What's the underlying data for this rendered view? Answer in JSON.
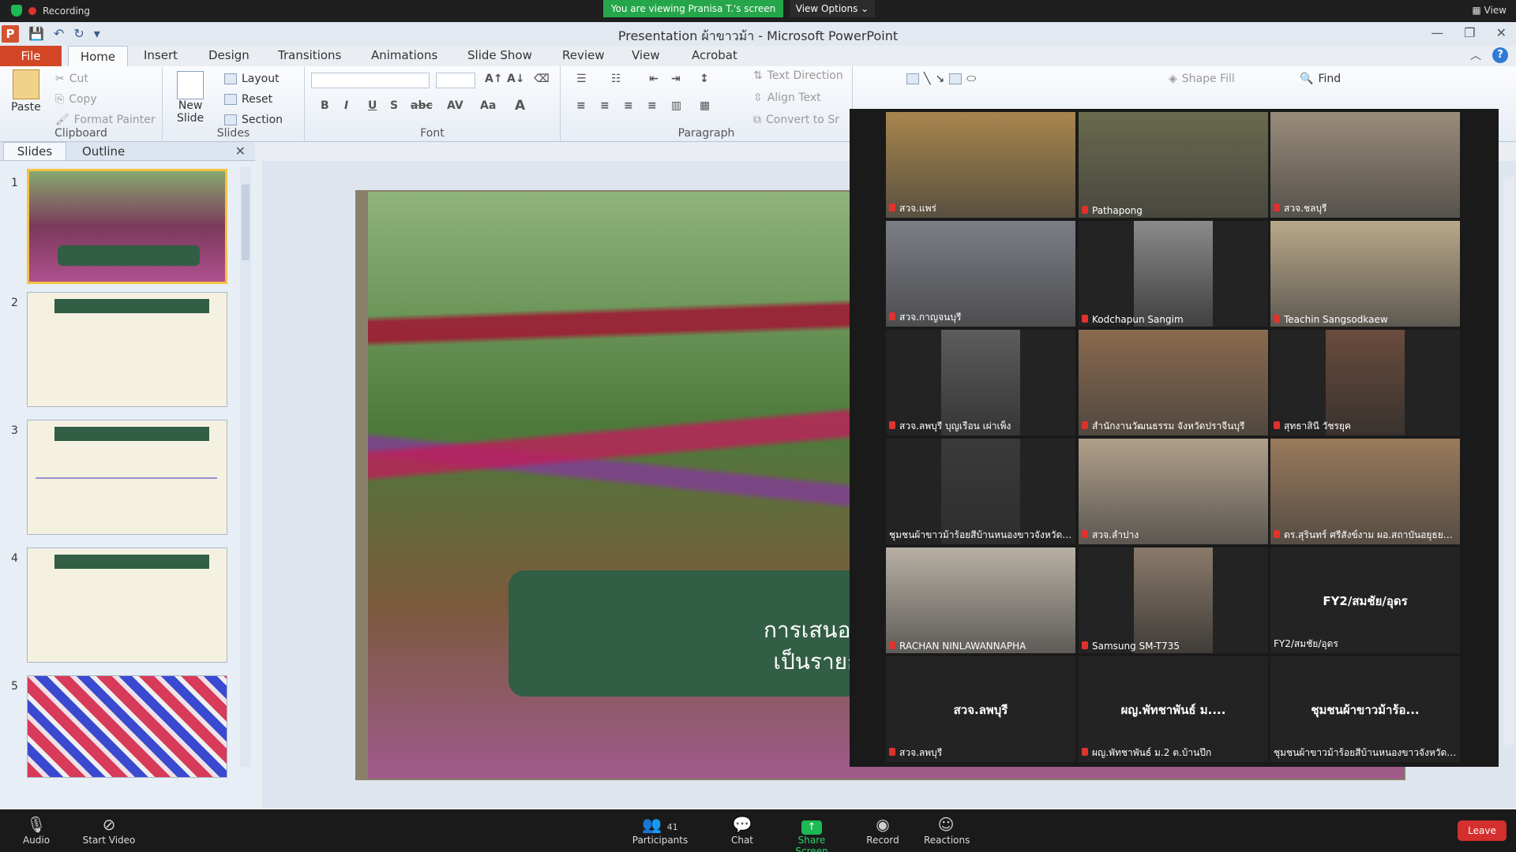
{
  "zoom": {
    "recording_label": "Recording",
    "viewing_banner": "You are viewing Pranisa T.'s screen",
    "view_options": "View Options ⌄",
    "view_label": "View",
    "bottom": {
      "audio": "Audio",
      "start_video": "Start Video",
      "participants": "Participants",
      "participants_count": "41",
      "chat": "Chat",
      "share_screen": "Share Screen",
      "record": "Record",
      "reactions": "Reactions",
      "leave": "Leave"
    },
    "tiles": [
      {
        "name": "สวจ.แพร่",
        "type": "video",
        "bg": "#a8864e"
      },
      {
        "name": "Pathapong",
        "type": "video",
        "bg": "#6a6a4e"
      },
      {
        "name": "สวจ.ชลบุรี",
        "type": "video",
        "bg": "#9a8c7a"
      },
      {
        "name": "สวจ.กาญจนบุรี",
        "type": "video",
        "bg": "#7c7e86"
      },
      {
        "name": "Kodchapun Sangim",
        "type": "video-narrow",
        "bg": "#8a8a8a"
      },
      {
        "name": "Teachin Sangsodkaew",
        "type": "video",
        "bg": "#b9a88a"
      },
      {
        "name": "สวจ.ลพบุรี บุญเรือน เผ่าเพ็ง",
        "type": "video-narrow",
        "bg": "#5c5c5c"
      },
      {
        "name": "สำนักงานวัฒนธรรม จังหวัดปราจีนบุรี",
        "type": "video",
        "bg": "#8a6a4e"
      },
      {
        "name": "สุทธาสินี วัชรยุค",
        "type": "video-narrow",
        "bg": "#6a4c3c"
      },
      {
        "name": "ชุมชนผ้าขาวม้าร้อยสีบ้านหนองขาวจังหวัดกา...",
        "type": "video-narrow",
        "bg": "#3a3a3a",
        "nomic": true
      },
      {
        "name": "สวจ.ลำปาง",
        "type": "video",
        "bg": "#b0a08a"
      },
      {
        "name": "ดร.สุรินทร์ ศรีสังข์งาม ผอ.สถาบันอยุธยาศึ...",
        "type": "video",
        "bg": "#9a7a5c"
      },
      {
        "name": "RACHAN NINLAWANNAPHA",
        "type": "video",
        "bg": "#b8b0a4"
      },
      {
        "name": "Samsung SM-T735",
        "type": "video-narrow",
        "bg": "#8a7a6a"
      },
      {
        "name": "FY2/สมชัย/อุดร",
        "type": "name",
        "center": "FY2/สมชัย/อุดร",
        "nomic": true
      },
      {
        "name": "สวจ.ลพบุรี",
        "type": "name",
        "center": "สวจ.ลพบุรี"
      },
      {
        "name": "ผญ.พัทชาพันธ์ ม.2 ต.บ้านปึก",
        "type": "name",
        "center": "ผญ.พัทชาพันธ์ ม...."
      },
      {
        "name": "ชุมชนผ้าขาวม้าร้อยสีบ้านหนองขาวจังหวัดกา...",
        "type": "name",
        "center": "ชุมชนผ้าขาวม้าร้อ...",
        "nomic": true
      }
    ]
  },
  "ppt": {
    "title": "Presentation ผ้าขาวม้า - Microsoft PowerPoint",
    "tabs": [
      "File",
      "Home",
      "Insert",
      "Design",
      "Transitions",
      "Animations",
      "Slide Show",
      "Review",
      "View",
      "Acrobat"
    ],
    "clipboard": {
      "label": "Clipboard",
      "paste": "Paste",
      "cut": "Cut",
      "copy": "Copy",
      "format_painter": "Format Painter"
    },
    "slides_grp": {
      "label": "Slides",
      "new_slide_1": "New",
      "new_slide_2": "Slide",
      "layout": "Layout",
      "reset": "Reset",
      "section": "Section"
    },
    "font_grp": {
      "label": "Font"
    },
    "paragraph_grp": {
      "label": "Paragraph",
      "text_direction": "Text Direction",
      "align_text": "Align Text",
      "convert": "Convert to Sr"
    },
    "drawing": {
      "shape_fill": "Shape Fill",
      "find": "Find"
    },
    "pane": {
      "slides_tab": "Slides",
      "outline_tab": "Outline",
      "thumb_numbers": [
        "1",
        "2",
        "3",
        "4",
        "5"
      ]
    },
    "slide_text": [
      "การเ",
      "การเสนอข้อมูลมรดกภูมิปัญญ",
      "เป็นรายการตัวแทนมรดกวัฒ"
    ]
  }
}
